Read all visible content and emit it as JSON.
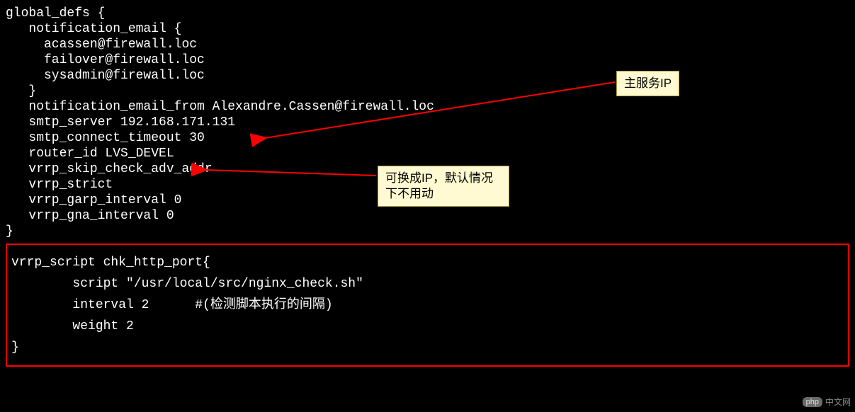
{
  "code": {
    "l1": "global_defs {",
    "l2": "   notification_email {",
    "l3": "     acassen@firewall.loc",
    "l4": "     failover@firewall.loc",
    "l5": "     sysadmin@firewall.loc",
    "l6": "   }",
    "l7": "   notification_email_from Alexandre.Cassen@firewall.loc",
    "l8": "   smtp_server 192.168.171.131",
    "l9": "   smtp_connect_timeout 30",
    "l10": "   router_id LVS_DEVEL",
    "l11": "   vrrp_skip_check_adv_addr",
    "l12": "   vrrp_strict",
    "l13": "   vrrp_garp_interval 0",
    "l14": "   vrrp_gna_interval 0",
    "l15": "}"
  },
  "script": {
    "l1": "vrrp_script chk_http_port{",
    "l2": "        script \"/usr/local/src/nginx_check.sh\"",
    "l3": "",
    "l4": "        interval 2      #(检测脚本执行的间隔)",
    "l5": "",
    "l6": "        weight 2",
    "l7": "}"
  },
  "annotations": {
    "a1": "主服务IP",
    "a2": "可换成IP，默认情况下不用动"
  },
  "watermark": {
    "chip": "php",
    "text": "中文网"
  }
}
